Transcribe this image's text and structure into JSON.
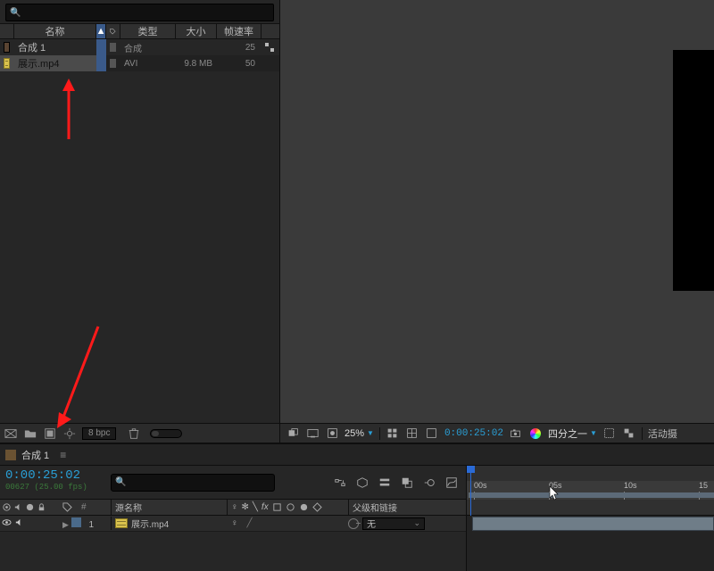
{
  "project": {
    "search_placeholder": "",
    "columns": {
      "name": "名称",
      "type": "类型",
      "size": "大小",
      "fps": "帧速率"
    },
    "rows": [
      {
        "name": "合成 1",
        "kind": "comp",
        "type": "合成",
        "size": "",
        "fps": "25"
      },
      {
        "name": "展示.mp4",
        "kind": "vid",
        "type": "AVI",
        "size": "9.8 MB",
        "fps": "50"
      }
    ],
    "bpc_label": "8 bpc"
  },
  "viewer": {
    "zoom": "25%",
    "timecode": "0:00:25:02",
    "resolution_label": "四分之一",
    "active_label": "活动摄"
  },
  "timeline": {
    "tab": "合成 1",
    "timecode": "0:00:25:02",
    "frame_info": "00627 (25.00 fps)",
    "search_placeholder": "",
    "columns": {
      "source_name": "源名称",
      "switches": "♀ ✻ \\ fx",
      "parent": "父级和链接"
    },
    "layers": [
      {
        "index": "1",
        "name": "展示.mp4",
        "switch1": "♀",
        "parent_label": "无"
      }
    ],
    "ruler": [
      "00s",
      "05s",
      "10s",
      "15"
    ]
  }
}
